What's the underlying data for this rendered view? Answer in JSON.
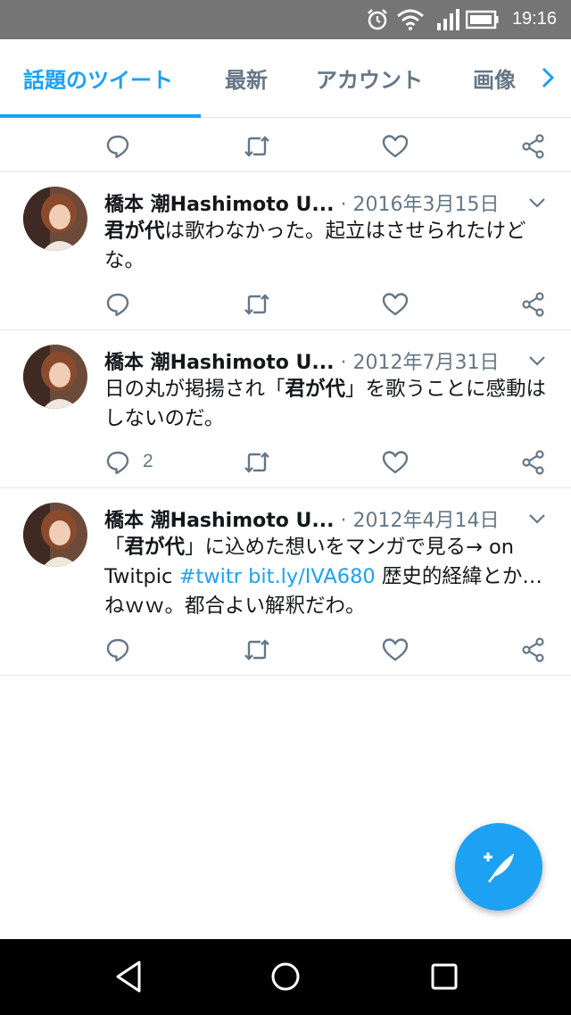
{
  "status_bar": {
    "time": "19:16"
  },
  "tabs": [
    {
      "label": "話題のツイート"
    },
    {
      "label": "最新"
    },
    {
      "label": "アカウント"
    },
    {
      "label": "画像"
    }
  ],
  "tweets": [
    {
      "author": "橋本 潮Hashimoto U...",
      "separator": "·",
      "date": "2016年3月15日",
      "text_bold": "君が代",
      "text_rest": "は歌わなかった。起立はさせられたけどな。",
      "reply_count": ""
    },
    {
      "author": "橋本 潮Hashimoto U...",
      "separator": "·",
      "date": "2012年7月31日",
      "text_pre": "日の丸が掲揚され「",
      "text_bold": "君が代",
      "text_rest": "」を歌うことに感動はしないのだ。",
      "reply_count": "2"
    },
    {
      "author": "橋本 潮Hashimoto U...",
      "separator": "·",
      "date": "2012年4月14日",
      "text_pre": "「",
      "text_bold": "君が代",
      "text_mid": "」に込めた想いをマンガで見る→ on Twitpic ",
      "hashtag": "#twitr",
      "link": "bit.ly/IVA680",
      "text_rest": " 歴史的経緯とか…ねｗｗ。都合よい解釈だわ。",
      "reply_count": ""
    }
  ]
}
